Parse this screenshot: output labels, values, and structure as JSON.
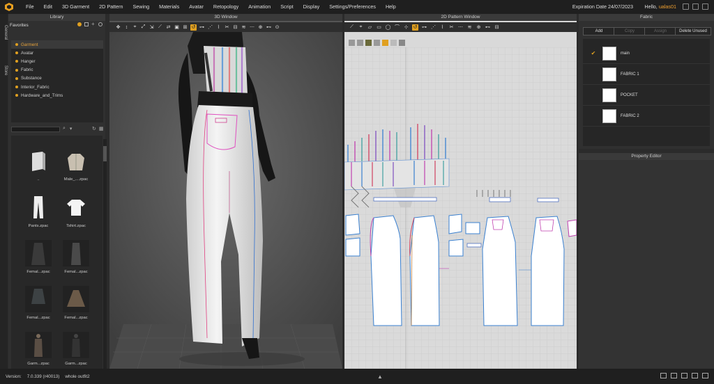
{
  "menubar": {
    "items": [
      "File",
      "Edit",
      "3D Garment",
      "2D Pattern",
      "Sewing",
      "Materials",
      "Avatar",
      "Retopology",
      "Animation",
      "Script",
      "Display",
      "Settings/Preferences",
      "Help"
    ],
    "expiry": "Expiration Date 24/07/2023",
    "hello_prefix": "Hello,",
    "username": "ualas01"
  },
  "sidebar_tabs": [
    "General",
    "Store"
  ],
  "library": {
    "title": "Library",
    "favorites_label": "Favorites",
    "favorites": [
      "Garment",
      "Avatar",
      "Hanger",
      "Fabric",
      "Substance",
      "Interior_Fabric",
      "Hardware_and_Trims"
    ],
    "items": [
      {
        "label": ".."
      },
      {
        "label": "Male_....zpac"
      },
      {
        "label": "Pants.zpac"
      },
      {
        "label": "Tshirt.zpac"
      },
      {
        "label": "Femal...zpac"
      },
      {
        "label": "Femal...zpac"
      },
      {
        "label": "Femal...zpac"
      },
      {
        "label": "Femal...zpac"
      },
      {
        "label": "Garm...zpac"
      },
      {
        "label": "Garm...zpac"
      }
    ]
  },
  "window3d": {
    "title": "3D Window"
  },
  "window2d": {
    "title": "2D Pattern Window"
  },
  "fabric": {
    "title": "Fabric",
    "buttons": {
      "add": "Add",
      "copy": "Copy",
      "assign": "Assign",
      "delete_unused": "Delete Unused"
    },
    "items": [
      {
        "name": "main",
        "checked": true
      },
      {
        "name": "FABRIC 1",
        "checked": false
      },
      {
        "name": "POCKET",
        "checked": false
      },
      {
        "name": "FABRIC 2",
        "checked": false
      }
    ]
  },
  "property_editor": {
    "title": "Property Editor"
  },
  "status": {
    "version_label": "Version:",
    "version": "7.0.339 (r40013)",
    "file": "whole outfit2"
  },
  "colors": {
    "accent": "#e0a020",
    "bg": "#2b2b2b"
  }
}
